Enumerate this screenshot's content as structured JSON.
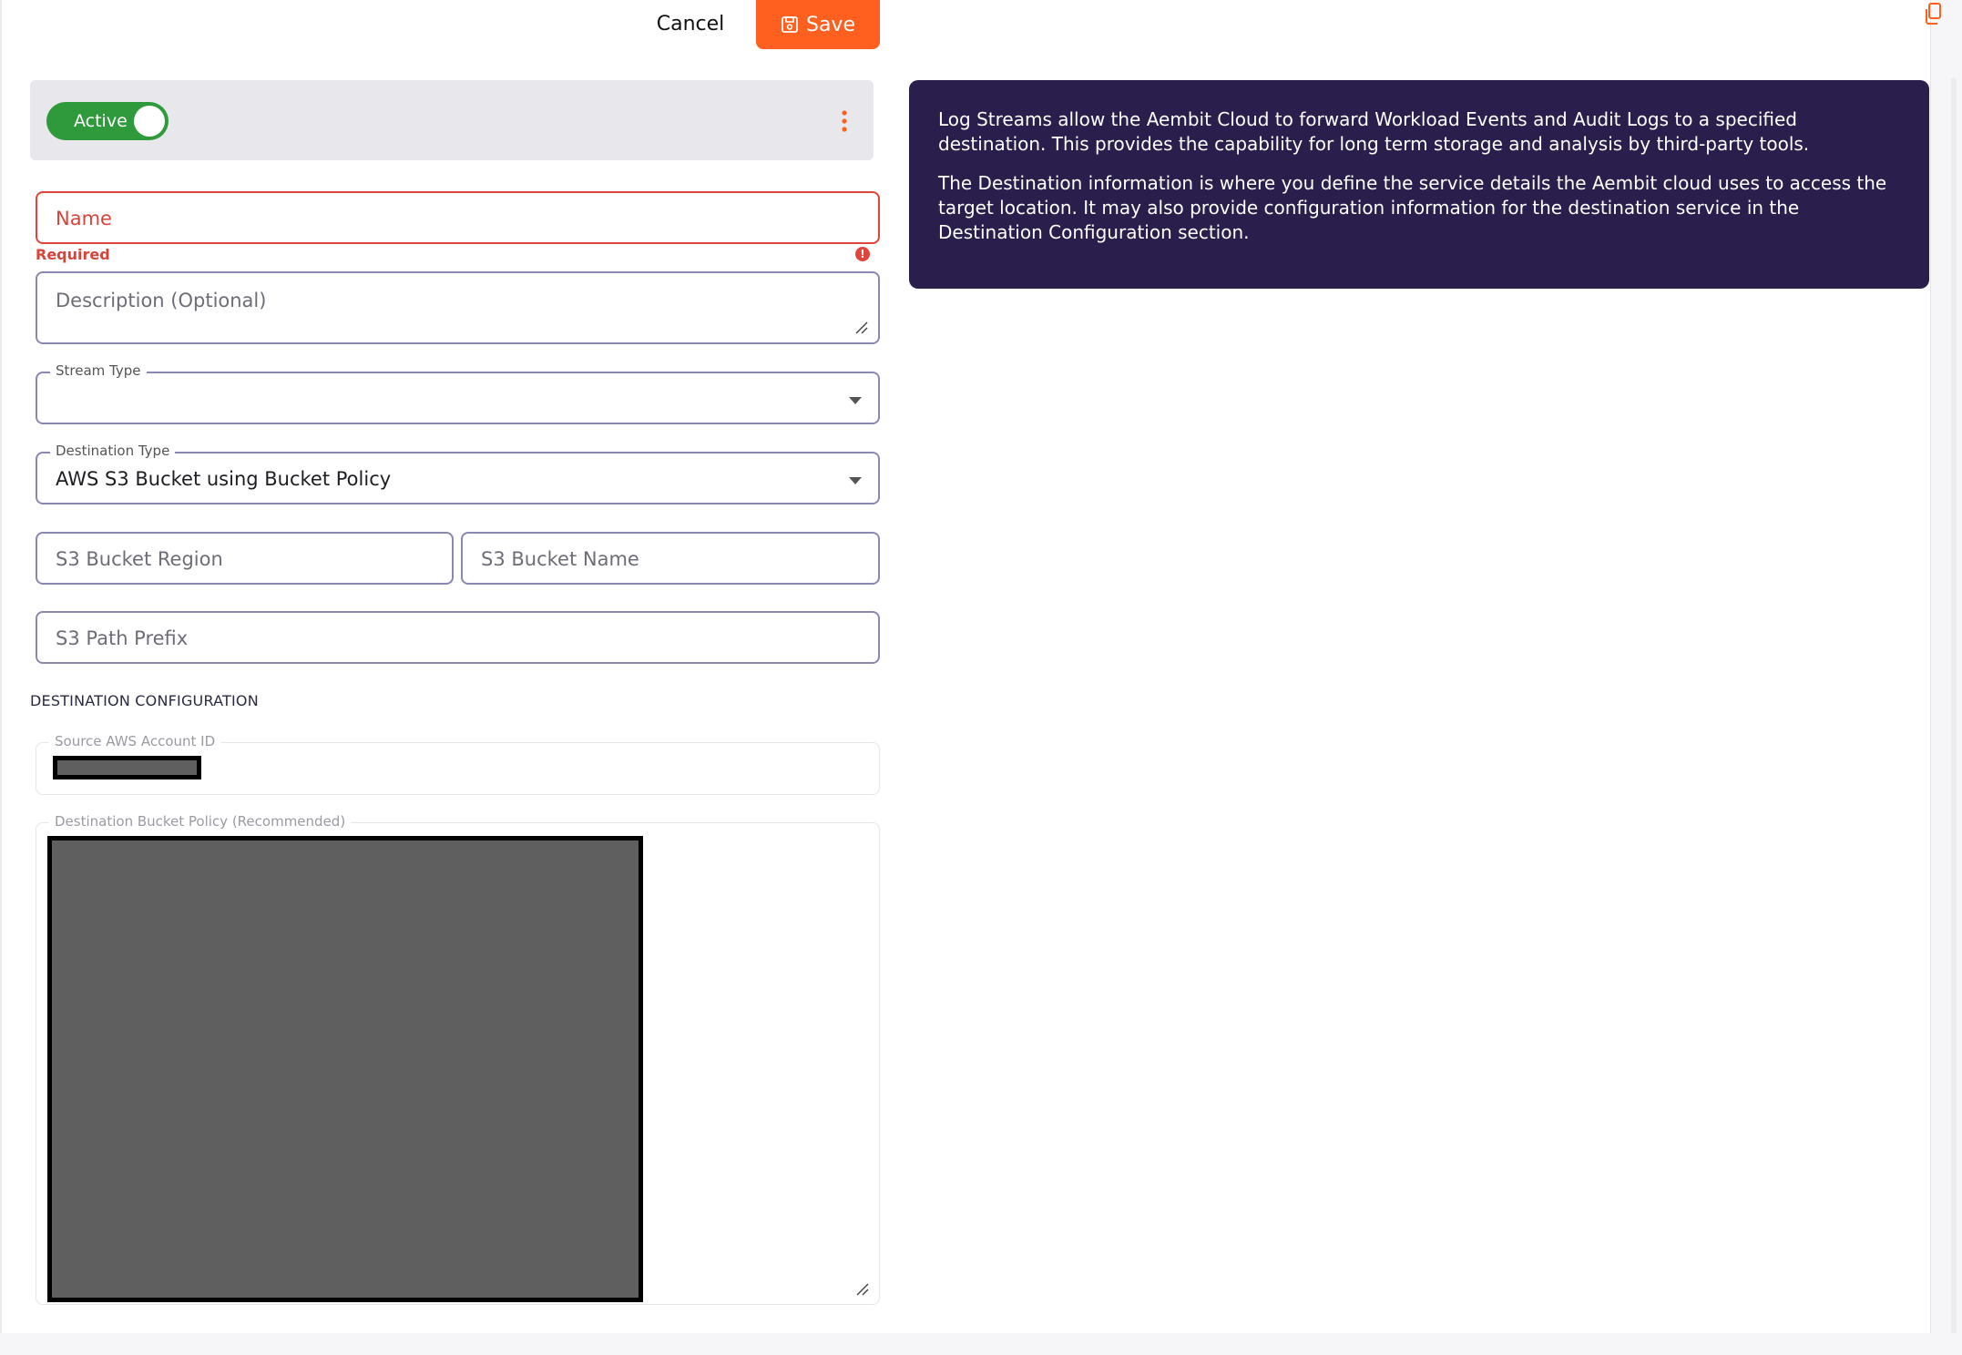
{
  "header": {
    "cancel_label": "Cancel",
    "save_label": "Save"
  },
  "status": {
    "toggle_label": "Active",
    "active": true
  },
  "form": {
    "name": {
      "placeholder": "Name",
      "error": "Required"
    },
    "description": {
      "placeholder": "Description (Optional)"
    },
    "stream_type": {
      "label": "Stream Type",
      "value": ""
    },
    "destination_type": {
      "label": "Destination Type",
      "value": "AWS S3 Bucket using Bucket Policy"
    },
    "s3_bucket_region": {
      "placeholder": "S3 Bucket Region"
    },
    "s3_bucket_name": {
      "placeholder": "S3 Bucket Name"
    },
    "s3_path_prefix": {
      "placeholder": "S3 Path Prefix"
    }
  },
  "destination_configuration": {
    "heading": "DESTINATION CONFIGURATION",
    "source_account_label": "Source AWS Account ID",
    "bucket_policy_label": "Destination Bucket Policy (Recommended)"
  },
  "info": {
    "paragraph1": "Log Streams allow the Aembit Cloud to forward Workload Events and Audit Logs to a specified destination. This provides the capability for long term storage and analysis by third-party tools.",
    "paragraph2": "The Destination information is where you define the service details the Aembit cloud uses to access the target location. It may also provide configuration information for the destination service in the Destination Configuration section."
  },
  "colors": {
    "accent": "#ff5f1f",
    "active_green": "#2e9a3c",
    "error": "#d9443a",
    "info_bg": "#2a1e4c"
  },
  "icons": [
    "save-icon",
    "copy-icon",
    "kebab-menu-icon",
    "chevron-down-icon",
    "error-icon",
    "resize-handle-icon"
  ]
}
